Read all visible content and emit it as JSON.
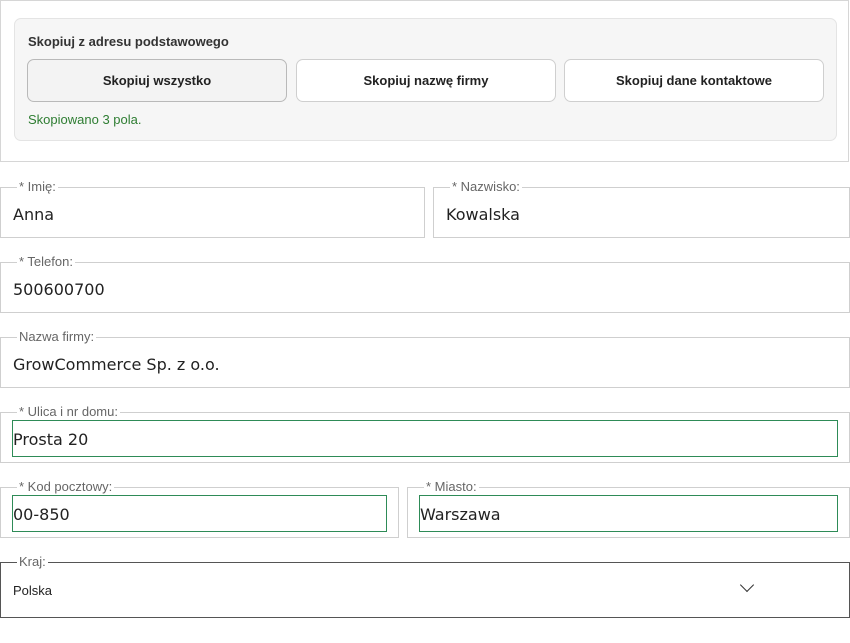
{
  "copy_panel": {
    "title": "Skopiuj z adresu podstawowego",
    "buttons": [
      "Skopiuj wszystko",
      "Skopiuj nazwę firmy",
      "Skopiuj dane kontaktowe"
    ],
    "status": "Skopiowano 3 pola."
  },
  "fields": {
    "first_name": {
      "label": "* Imię:",
      "value": "Anna"
    },
    "last_name": {
      "label": "* Nazwisko:",
      "value": "Kowalska"
    },
    "phone": {
      "label": "* Telefon:",
      "value": "500600700"
    },
    "company": {
      "label": "Nazwa firmy:",
      "value": "GrowCommerce Sp. z o.o."
    },
    "street": {
      "label": "* Ulica i nr domu:",
      "value": "Prosta 20"
    },
    "postal_code": {
      "label": "* Kod pocztowy:",
      "value": "00-850"
    },
    "city": {
      "label": "* Miasto:",
      "value": "Warszawa"
    },
    "country": {
      "label": "Kraj:",
      "value": "Polska"
    }
  },
  "colors": {
    "success": "#2e7d32",
    "focus_outline": "#2e8b57"
  },
  "icons": {
    "country_dropdown": "chevron-down-icon"
  }
}
